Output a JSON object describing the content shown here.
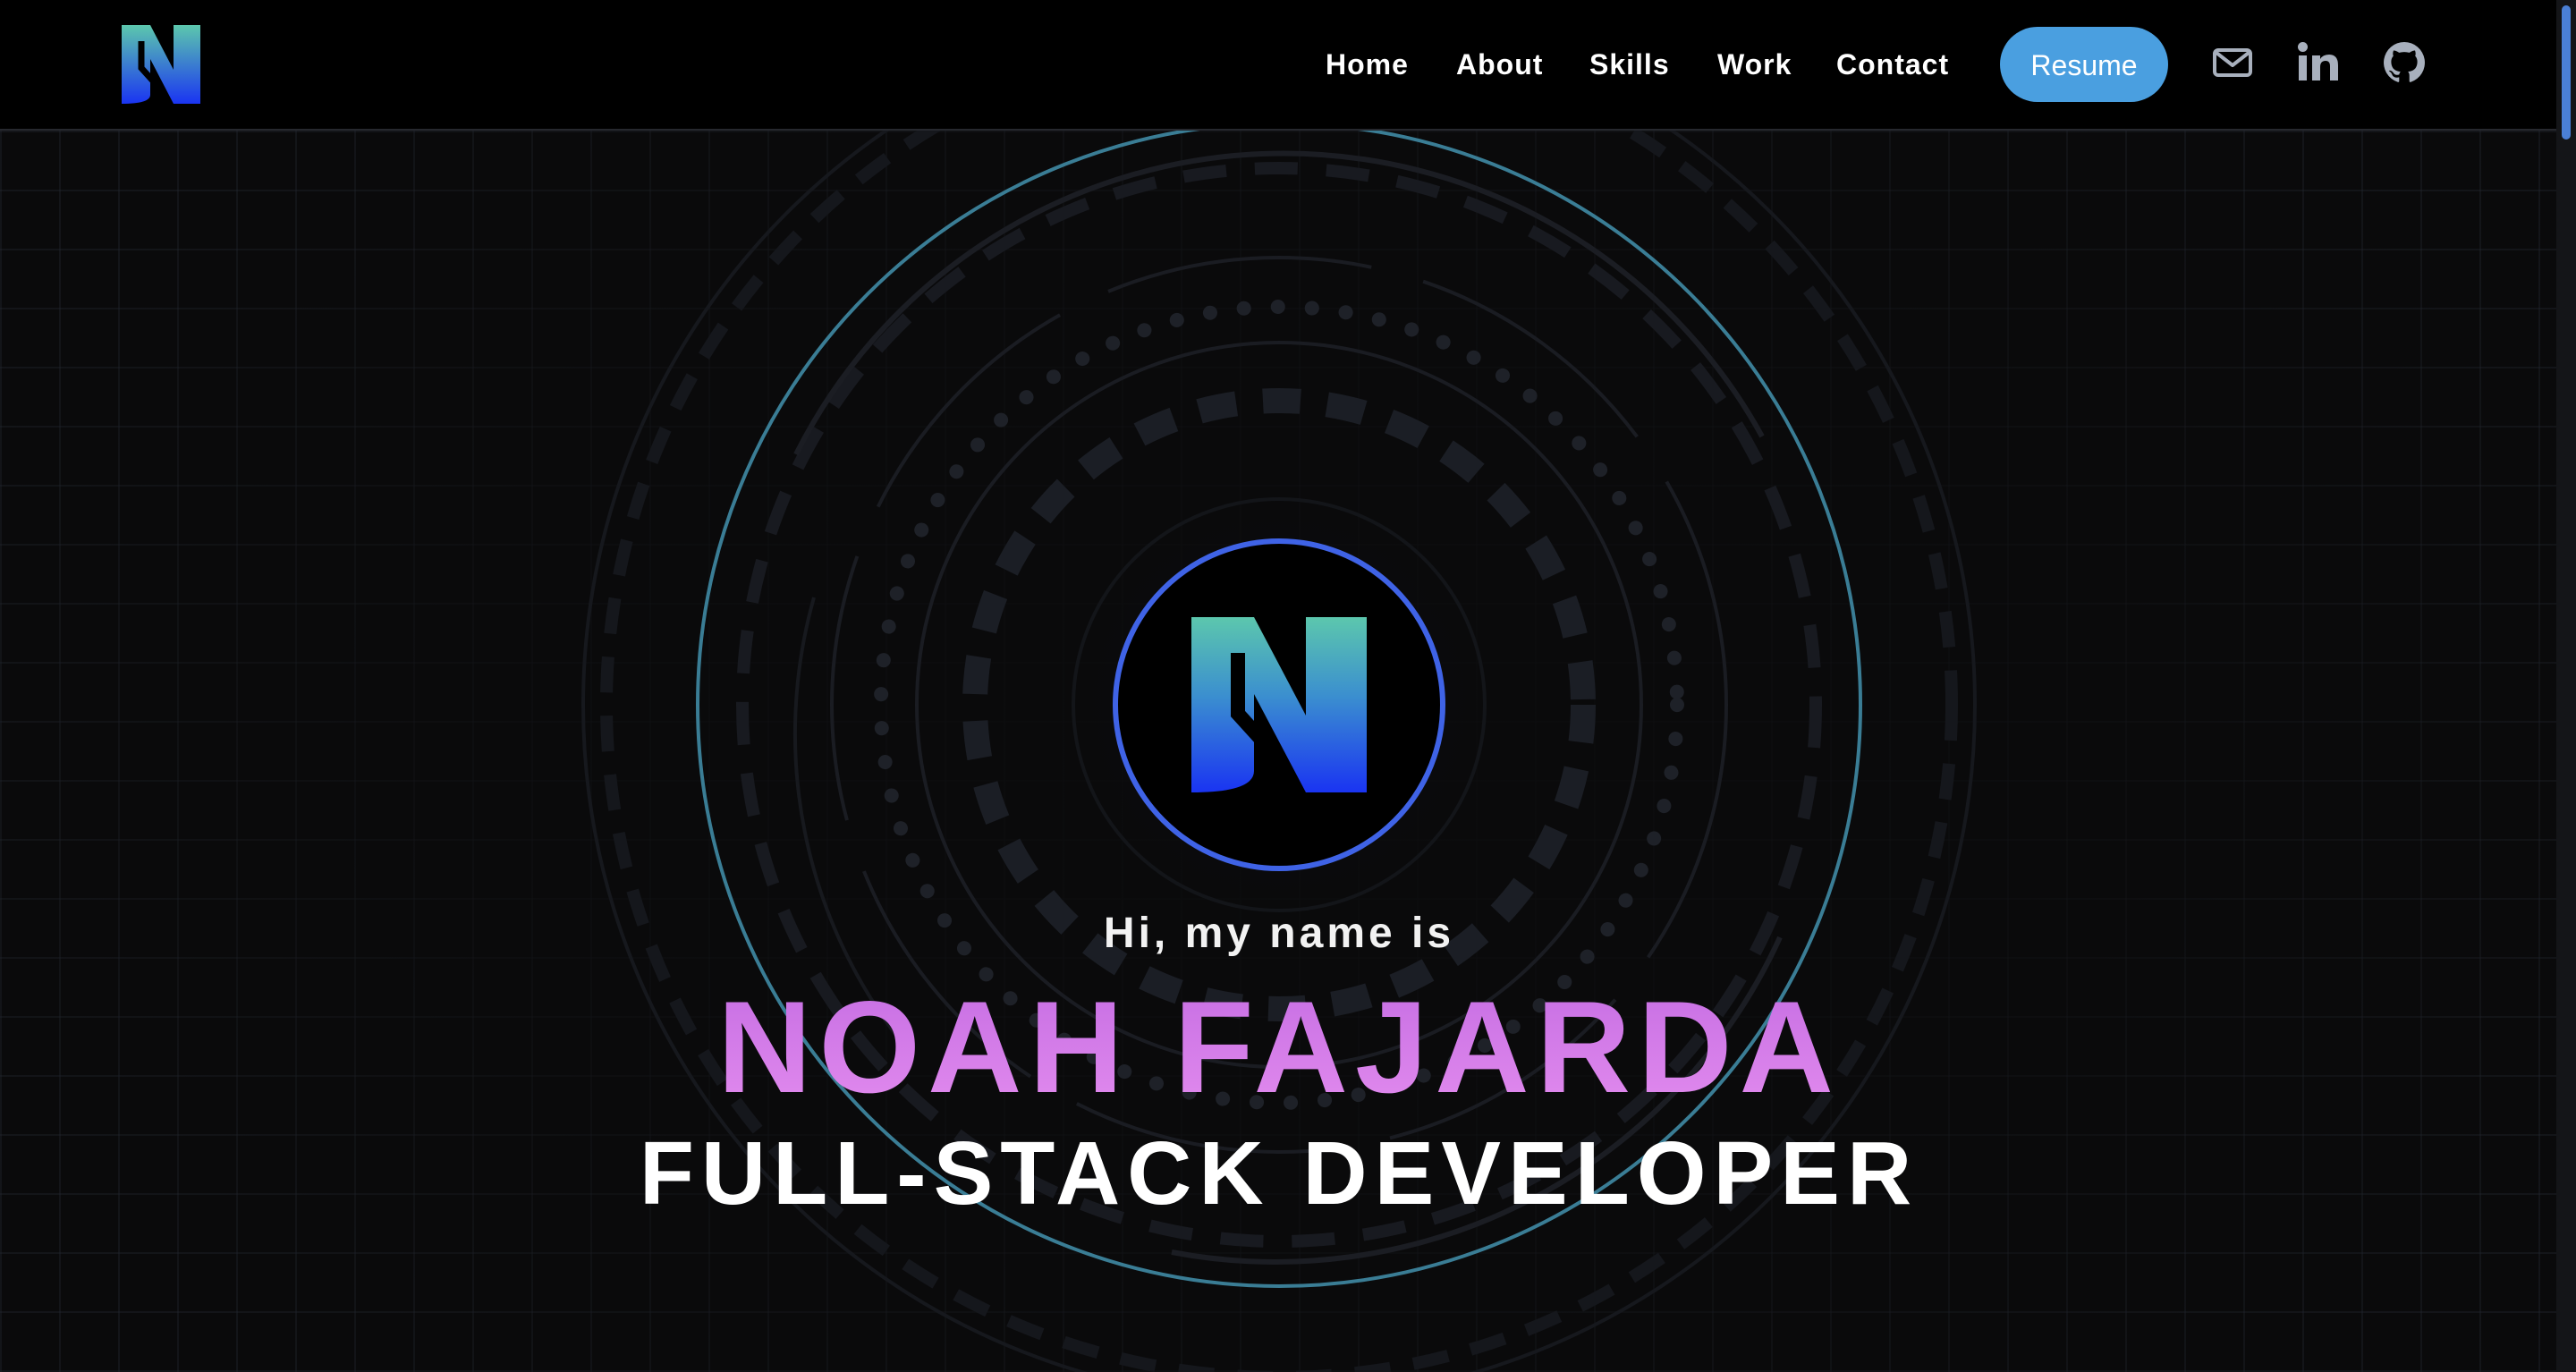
{
  "nav": {
    "items": [
      {
        "label": "Home"
      },
      {
        "label": "About"
      },
      {
        "label": "Skills"
      },
      {
        "label": "Work"
      },
      {
        "label": "Contact"
      }
    ],
    "resume_label": "Resume",
    "icons": [
      "mail-icon",
      "linkedin-icon",
      "github-icon"
    ]
  },
  "hero": {
    "greeting": "Hi, my name is",
    "name": "NOAH FAJARDA",
    "role": "FULL-STACK DEVELOPER"
  },
  "colors": {
    "background": "#0a0a0b",
    "header": "#000000",
    "accent_button": "#4a9fe0",
    "name_gradient_start": "#c66ee3",
    "name_gradient_end": "#e28bee",
    "logo_gradient_top": "#57c1b0",
    "logo_gradient_bottom": "#1f3cf0",
    "ring_accent": "#3a7d95",
    "logo_ring": "#3f63e6"
  }
}
